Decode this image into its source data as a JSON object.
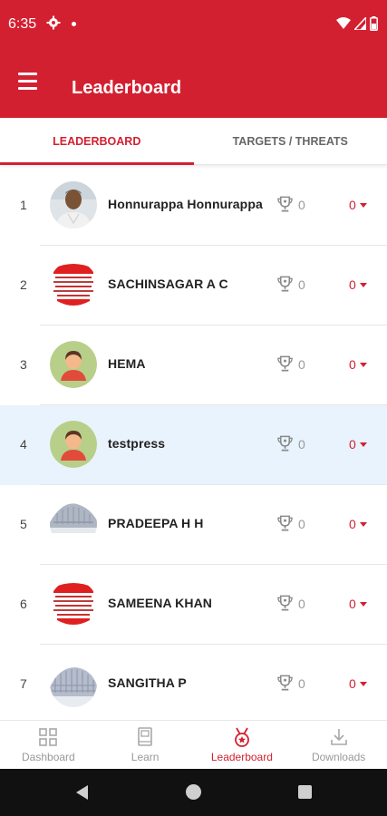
{
  "status_bar": {
    "time": "6:35"
  },
  "app_bar": {
    "title": "Leaderboard"
  },
  "tabs": [
    {
      "label": "LEADERBOARD",
      "active": true
    },
    {
      "label": "TARGETS / THREATS",
      "active": false
    }
  ],
  "leaderboard": [
    {
      "rank": "1",
      "name": "Honnurappa Honnurappa",
      "trophies": "0",
      "change": "0",
      "avatar": "photo-avatar"
    },
    {
      "rank": "2",
      "name": "SACHINSAGAR A C",
      "trophies": "0",
      "change": "0",
      "avatar": "badge-avatar"
    },
    {
      "rank": "3",
      "name": "HEMA",
      "trophies": "0",
      "change": "0",
      "avatar": "default-avatar"
    },
    {
      "rank": "4",
      "name": "testpress",
      "trophies": "0",
      "change": "0",
      "avatar": "default-avatar",
      "highlighted": true
    },
    {
      "rank": "5",
      "name": "PRADEEPA H H",
      "trophies": "0",
      "change": "0",
      "avatar": "building-avatar"
    },
    {
      "rank": "6",
      "name": "SAMEENA KHAN",
      "trophies": "0",
      "change": "0",
      "avatar": "badge-avatar"
    },
    {
      "rank": "7",
      "name": "SANGITHA P",
      "trophies": "0",
      "change": "0",
      "avatar": "building-avatar"
    }
  ],
  "bottom_nav": [
    {
      "label": "Dashboard",
      "icon": "grid-icon",
      "active": false
    },
    {
      "label": "Learn",
      "icon": "book-icon",
      "active": false
    },
    {
      "label": "Leaderboard",
      "icon": "medal-icon",
      "active": true
    },
    {
      "label": "Downloads",
      "icon": "download-icon",
      "active": false
    }
  ],
  "colors": {
    "primary": "#d32030",
    "highlight_row": "#e8f3fd",
    "inactive": "#999999"
  }
}
